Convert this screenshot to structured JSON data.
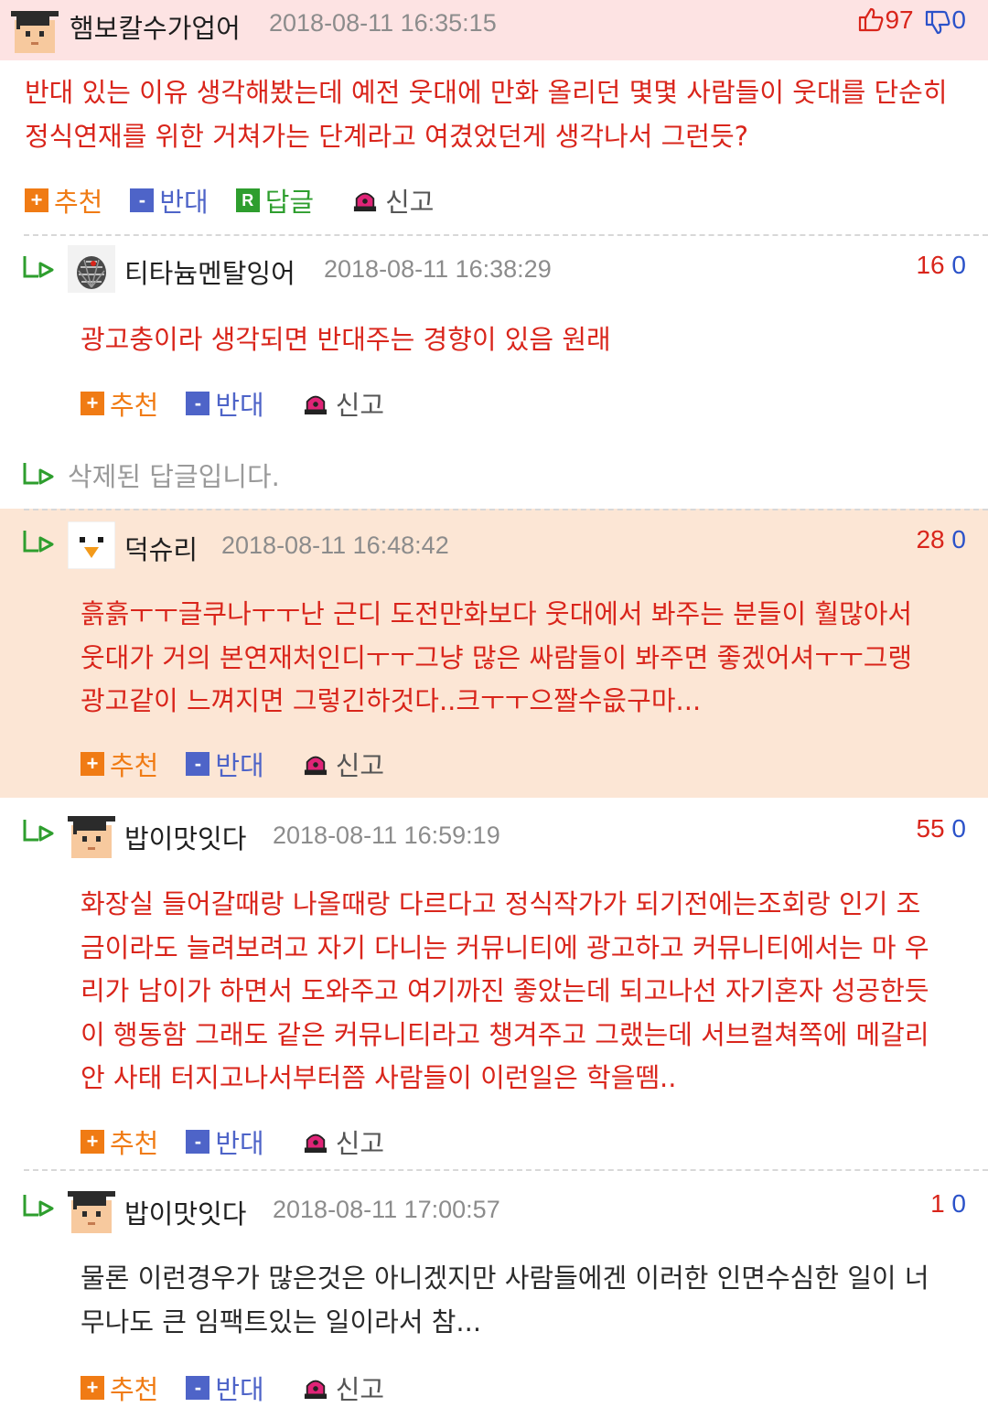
{
  "top_comment": {
    "nickname": "햄보칼수가업어",
    "timestamp": "2018-08-11 16:35:15",
    "likes": "97",
    "dislikes": "0",
    "lines": [
      "반대 있는 이유 생각해봤는데 예전 웃대에 만화 올리던 몇몇 사람들이 웃대를 단순히",
      "정식연재를 위한 거쳐가는 단계라고 여겼었던게 생각나서 그런듯?"
    ]
  },
  "actions": {
    "recommend": "추천",
    "oppose": "반대",
    "reply": "답글",
    "reply_icon_letter": "R",
    "report": "신고",
    "plus": "+",
    "minus": "-"
  },
  "replies": [
    {
      "nickname": "티타늄멘탈잉어",
      "timestamp": "2018-08-11 16:38:29",
      "likes": "16",
      "dislikes": "0",
      "lines": [
        "광고충이라 생각되면 반대주는 경향이 있음 원래"
      ]
    },
    {
      "deleted_text": "삭제된 답글입니다."
    },
    {
      "nickname": "덕슈리",
      "timestamp": "2018-08-11 16:48:42",
      "likes": "28",
      "dislikes": "0",
      "lines": [
        "흙흙ㅜㅜ글쿠나ㅜㅜ난 근디 도전만화보다 웃대에서 봐주는 분들이 훨많아서",
        "웃대가 거의 본연재처인디ㅜㅜ그냥 많은 싸람들이 봐주면 좋겠어셔ㅜㅜ그랭",
        "광고같이 느껴지면 그렇긴하것다..크ㅜㅜ으짤수읎구마..."
      ]
    },
    {
      "nickname": "밥이맛잇다",
      "timestamp": "2018-08-11 16:59:19",
      "likes": "55",
      "dislikes": "0",
      "lines": [
        "화장실 들어갈때랑 나올때랑 다르다고 정식작가가 되기전에는조회랑 인기 조",
        "금이라도 늘려보려고 자기 다니는 커뮤니티에 광고하고 커뮤니티에서는 마 우",
        "리가 남이가 하면서 도와주고 여기까진 좋았는데 되고나선 자기혼자 성공한듯",
        "이 행동함 그래도 같은 커뮤니티라고 챙겨주고 그랬는데 서브컬쳐쪽에 메갈리",
        "안 사태 터지고나서부터쯤 사람들이 이런일은 학을뗌.."
      ]
    },
    {
      "nickname": "밥이맛잇다",
      "timestamp": "2018-08-11 17:00:57",
      "likes": "1",
      "dislikes": "0",
      "lines": [
        "물론 이런경우가 많은것은 아니겠지만 사람들에겐 이러한 인면수심한 일이 너",
        "무나도 큰 임팩트있는 일이라서 참..."
      ]
    }
  ],
  "colors": {
    "highlight_red_bg": "#fde3e3",
    "highlight_orange_bg": "#fce6d5",
    "text_red": "#d9251b",
    "like_red": "#d9251b",
    "dislike_blue": "#2b52c9",
    "reply_green": "#2e9e2e"
  },
  "icons": [
    "thumbs-up-icon",
    "thumbs-down-icon",
    "reply-arrow-icon",
    "siren-icon",
    "avatar-graduate",
    "avatar-pinecone",
    "avatar-duck"
  ]
}
